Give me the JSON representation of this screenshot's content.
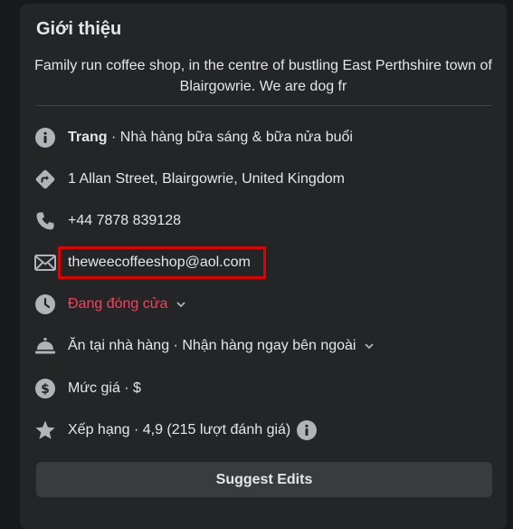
{
  "about": {
    "title": "Giới thiệu",
    "description": "Family run coffee shop, in the centre of bustling East Perthshire town of Blairgowrie. We are dog fr"
  },
  "rows": {
    "page": {
      "icon": "info-icon",
      "label": "Trang",
      "category": " · Nhà hàng bữa sáng & bữa nửa buổi"
    },
    "address": {
      "icon": "directions-icon",
      "text": "1 Allan Street, Blairgowrie, United Kingdom"
    },
    "phone": {
      "icon": "phone-icon",
      "text": "+44 7878 839128"
    },
    "email": {
      "icon": "mail-icon",
      "text": "theweecoffeeshop@aol.com"
    },
    "hours": {
      "icon": "clock-icon",
      "text": "Đang đóng cửa",
      "color": "#f3425f"
    },
    "service": {
      "icon": "service-bell-icon",
      "text": "Ăn tại nhà hàng · Nhận hàng ngay bên ngoài"
    },
    "price": {
      "icon": "dollar-icon",
      "text": "Mức giá · $"
    },
    "rating": {
      "icon": "star-icon",
      "text": "Xếp hạng · 4,9 (215 lượt đánh giá)"
    }
  },
  "suggest_button": "Suggest Edits"
}
